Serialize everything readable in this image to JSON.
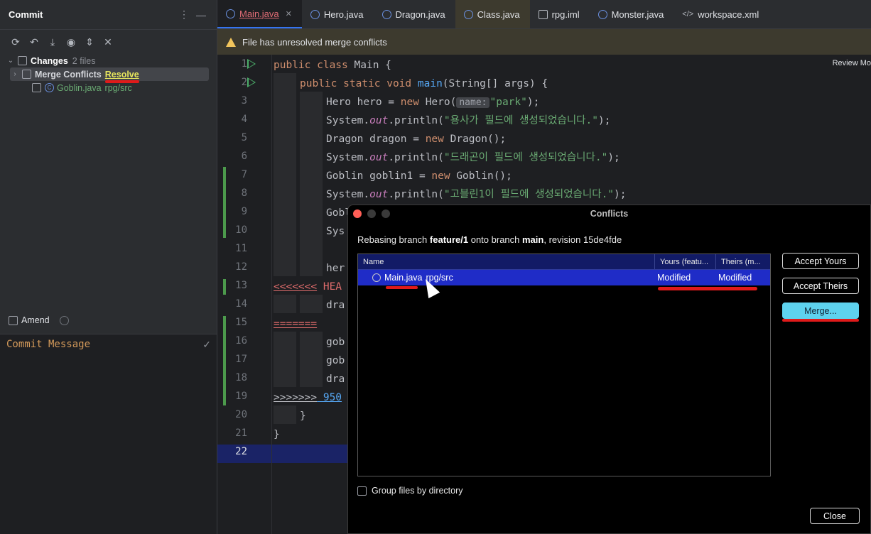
{
  "commit_panel": {
    "title": "Commit",
    "changes_label": "Changes",
    "changes_count": "2 files",
    "merge_conflicts_label": "Merge Conflicts",
    "resolve_label": "Resolve",
    "file_name": "Goblin.java",
    "file_path": "rpg/src",
    "amend_label": "Amend",
    "commit_message_placeholder": "Commit Message"
  },
  "tabs": [
    {
      "label": "Main.java"
    },
    {
      "label": "Hero.java"
    },
    {
      "label": "Dragon.java"
    },
    {
      "label": "Class.java"
    },
    {
      "label": "rpg.iml"
    },
    {
      "label": "Monster.java"
    },
    {
      "label": "workspace.xml"
    }
  ],
  "banner": {
    "text": "File has unresolved merge conflicts"
  },
  "editor": {
    "review_label": "Review Mo",
    "line_numbers": [
      "1",
      "2",
      "3",
      "4",
      "5",
      "6",
      "7",
      "8",
      "9",
      "10",
      "11",
      "12",
      "13",
      "14",
      "15",
      "16",
      "17",
      "18",
      "19",
      "20",
      "21",
      "22"
    ],
    "lines": {
      "l1_kw": "public class ",
      "l1_rest": "Main {",
      "l2_kw": "public static void ",
      "l2_fn": "main",
      "l2_rest": "(String[] args) {",
      "l3_a": "Hero hero = ",
      "l3_kw": "new ",
      "l3_b": "Hero(",
      "l3_hint": "name:",
      "l3_str": "\"park\"",
      "l3_c": ");",
      "l4_a": "System.",
      "l4_it": "out",
      "l4_b": ".println(",
      "l4_str": "\"용사가 필드에 생성되었습니다.\"",
      "l4_c": ");",
      "l5_a": "Dragon dragon = ",
      "l5_kw": "new ",
      "l5_b": "Dragon();",
      "l6_a": "System.",
      "l6_it": "out",
      "l6_b": ".println(",
      "l6_str": "\"드래곤이 필드에 생성되었습니다.\"",
      "l6_c": ");",
      "l7_a": "Goblin goblin1 = ",
      "l7_kw": "new ",
      "l7_b": "Goblin();",
      "l8_a": "System.",
      "l8_it": "out",
      "l8_b": ".println(",
      "l8_str": "\"고블린1이 필드에 생성되었습니다.\"",
      "l8_c": ");",
      "l9": "Gobl",
      "l10": "Sys",
      "l12": "her",
      "l13_mark": "<<<<<<<",
      "l13_rest": " HEA",
      "l14": "dra",
      "l15": "=======",
      "l16": "gob",
      "l17": "gob",
      "l18": "dra",
      "l19_mark": ">>>>>>>",
      "l19_rest": " 950",
      "l20": "}",
      "l21": "}"
    }
  },
  "dialog": {
    "title": "Conflicts",
    "subtitle_a": "Rebasing branch ",
    "subtitle_branch": "feature/1",
    "subtitle_b": " onto branch ",
    "subtitle_target": "main",
    "subtitle_c": ", revision 15de4fde",
    "columns": [
      "Name",
      "Yours (featu...",
      "Theirs (m..."
    ],
    "row": {
      "file": "Main.java",
      "path": "rpg/src",
      "yours": "Modified",
      "theirs": "Modified"
    },
    "buttons": {
      "accept_yours": "Accept Yours",
      "accept_theirs": "Accept Theirs",
      "merge": "Merge...",
      "close": "Close"
    },
    "group_label": "Group files by directory"
  },
  "colors": {
    "accent": "#3574f0",
    "merge_button": "#5ed2ee",
    "selection": "#1f2cc7",
    "annotation": "#e01a1a"
  }
}
